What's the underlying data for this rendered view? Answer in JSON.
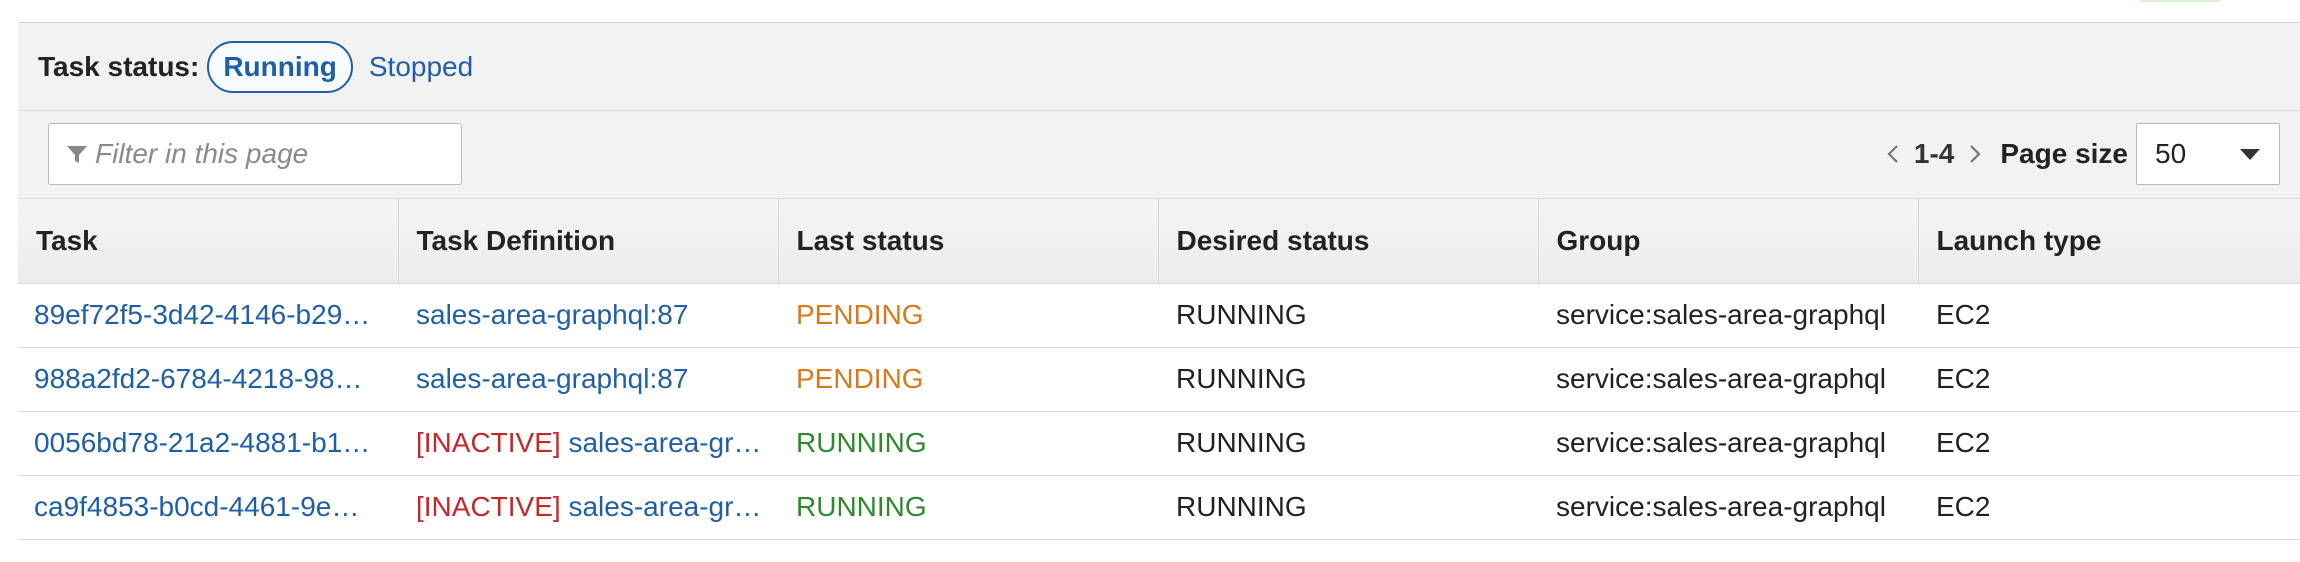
{
  "task_status": {
    "label": "Task status:",
    "running_label": "Running",
    "stopped_label": "Stopped"
  },
  "filter": {
    "placeholder": "Filter in this page"
  },
  "pagination": {
    "range": "1-4",
    "page_size_label": "Page size",
    "page_size_value": "50"
  },
  "table": {
    "columns": [
      "Task",
      "Task Definition",
      "Last status",
      "Desired status",
      "Group",
      "Launch type"
    ],
    "rows": [
      {
        "task": "89ef72f5-3d42-4146-b29…",
        "definition_prefix": "",
        "definition": "sales-area-graphql:87",
        "last_status": "PENDING",
        "desired_status": "RUNNING",
        "group": "service:sales-area-graphql",
        "launch_type": "EC2"
      },
      {
        "task": "988a2fd2-6784-4218-98…",
        "definition_prefix": "",
        "definition": "sales-area-graphql:87",
        "last_status": "PENDING",
        "desired_status": "RUNNING",
        "group": "service:sales-area-graphql",
        "launch_type": "EC2"
      },
      {
        "task": "0056bd78-21a2-4881-b1…",
        "definition_prefix": "[INACTIVE]",
        "definition": "sales-area-gr…",
        "last_status": "RUNNING",
        "desired_status": "RUNNING",
        "group": "service:sales-area-graphql",
        "launch_type": "EC2"
      },
      {
        "task": "ca9f4853-b0cd-4461-9e…",
        "definition_prefix": "[INACTIVE]",
        "definition": "sales-area-gr…",
        "last_status": "RUNNING",
        "desired_status": "RUNNING",
        "group": "service:sales-area-graphql",
        "launch_type": "EC2"
      }
    ]
  },
  "colors": {
    "link": "#1f5fa8",
    "pending": "#d97a1a",
    "running": "#2f8a2f",
    "inactive": "#c7262a"
  },
  "icons": {
    "filter": "filter-icon",
    "prev": "chevron-left-icon",
    "next": "chevron-right-icon",
    "dropdown": "caret-down-icon"
  }
}
